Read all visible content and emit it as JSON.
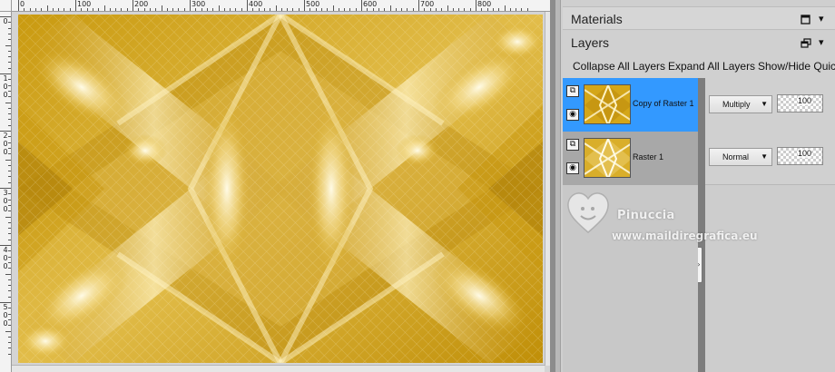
{
  "ruler": {
    "top_labels": [
      "0",
      "100",
      "200",
      "300",
      "400",
      "500",
      "600",
      "700",
      "800"
    ],
    "left_labels": [
      "0",
      "100",
      "200",
      "300",
      "400",
      "500"
    ]
  },
  "panels": {
    "materials": {
      "title": "Materials"
    },
    "layers": {
      "title": "Layers",
      "toolbar": [
        "Collapse All Layers",
        "Expand All Layers",
        "Show/Hide Quick"
      ],
      "items": [
        {
          "name": "Copy of Raster 1",
          "blend_mode": "Multiply",
          "opacity": "100",
          "selected": true
        },
        {
          "name": "Raster 1",
          "blend_mode": "Normal",
          "opacity": "100",
          "selected": false
        }
      ]
    }
  },
  "watermark": {
    "name": "Pinuccia",
    "url": "www.maildiregrafica.eu"
  },
  "icons": {
    "layer_group": "layers-stack-icon",
    "visibility": "eye-icon",
    "dropdown": "triangle-down-icon",
    "close": "close-square-icon",
    "float": "float-window-icon",
    "collapse_arrow": "chevron-down-icon"
  },
  "colors": {
    "selected_row": "#3399ff",
    "canvas_gold": "#d4a619",
    "highlight_gold": "#fff6d0"
  }
}
